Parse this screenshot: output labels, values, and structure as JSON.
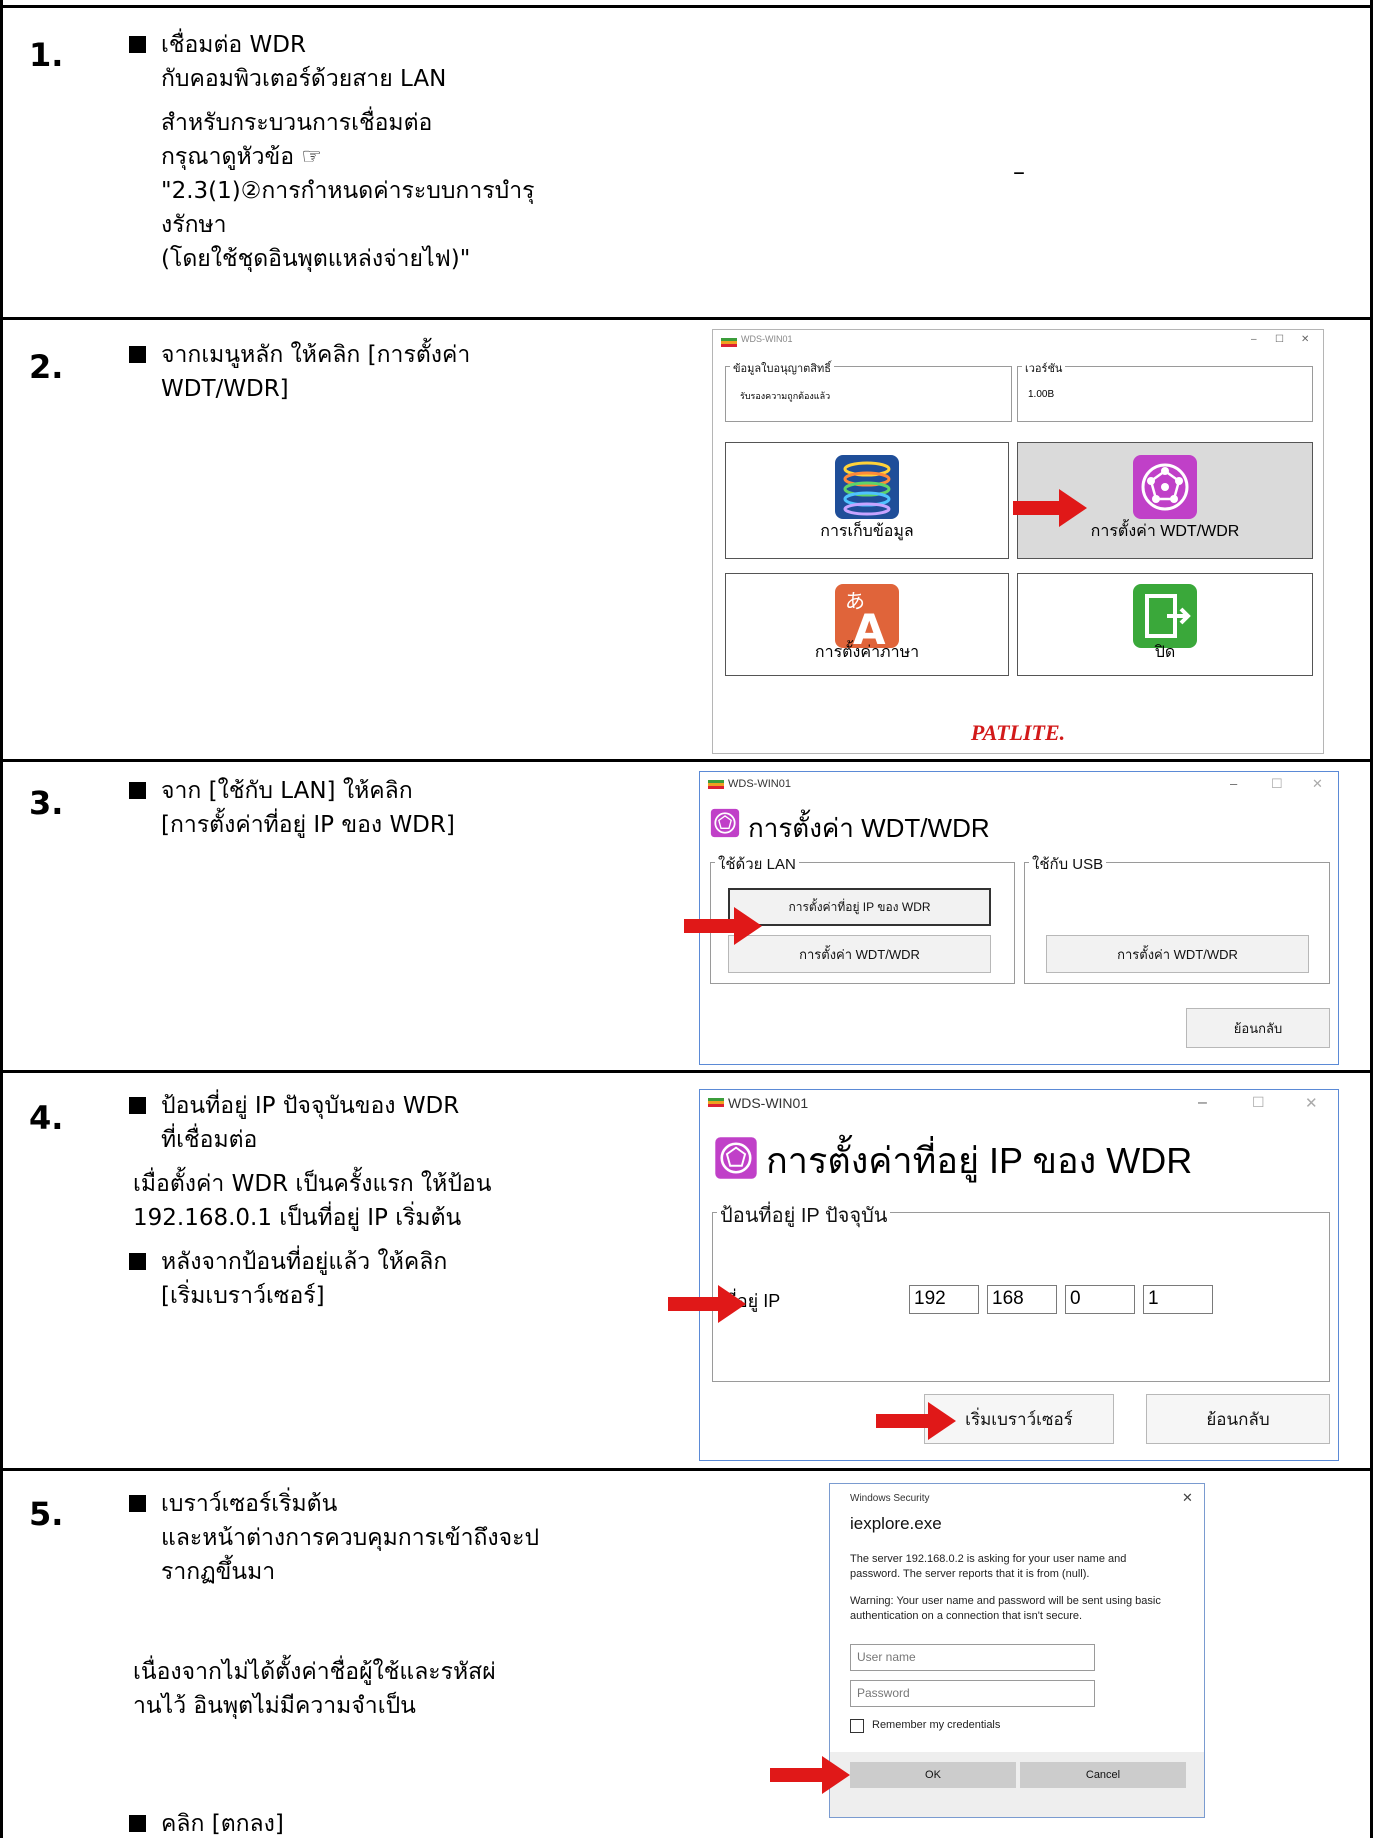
{
  "steps": [
    {
      "number": "1.",
      "lines": [
        "เชื่อมต่อ   WDR",
        "กับคอมพิวเตอร์ด้วยสาย   LAN",
        "สำหรับกระบวนการเชื่อมต่อ",
        "กรุณาดูหัวข้อ  ☞",
        "\"2.3(1)②การกำหนดค่าระบบการบำรุ",
        "งรักษา",
        "(โดยใช้ชุดอินพุตแหล่งจ่ายไฟ)\""
      ],
      "dash": "–"
    },
    {
      "number": "2.",
      "lines": [
        "จากเมนูหลัก   ให้คลิก   [การตั้งค่า",
        "WDT/WDR]"
      ]
    },
    {
      "number": "3.",
      "lines": [
        "จาก   [ใช้กับ   LAN] ให้คลิก",
        "[การตั้งค่าที่อยู่   IP ของ   WDR]"
      ]
    },
    {
      "number": "4.",
      "lines": [
        "ป้อนที่อยู่   IP ปัจจุบันของ   WDR",
        "ที่เชื่อมต่อ",
        "เมื่อตั้งค่า  WDR เป็นครั้งแรก  ให้ป้อน",
        "192.168.0.1 เป็นที่อยู่   IP เริ่มต้น",
        "หลังจากป้อนที่อยู่แล้ว   ให้คลิก",
        "[เริ่มเบราว์เซอร์]"
      ]
    },
    {
      "number": "5.",
      "lines": [
        "เบราว์เซอร์เริ่มต้น",
        "และหน้าต่างการควบคุมการเข้าถึงจะป",
        "รากฏขึ้นมา",
        "เนื่องจากไม่ได้ตั้งค่าชื่อผู้ใช้และรหัสผ่",
        "านไว้   อินพุตไม่มีความจำเป็น",
        "คลิก   [ตกลง]"
      ]
    }
  ],
  "screen2": {
    "window_title": "WDS-WIN01",
    "license_legend": "ข้อมูลใบอนุญาตสิทธิ์",
    "license_value": "รับรองความถูกต้องแล้ว",
    "version_legend": "เวอร์ชัน",
    "version_value": "1.00B",
    "tiles": [
      "การเก็บข้อมูล",
      "การตั้งค่า WDT/WDR",
      "การตั้งค่าภาษา",
      "ปิด"
    ],
    "brand": "PATLITE."
  },
  "screen3": {
    "window_title": "WDS-WIN01",
    "heading": "การตั้งค่า WDT/WDR",
    "lan_legend": "ใช้ด้วย LAN",
    "usb_legend": "ใช้กับ USB",
    "btn_ip": "การตั้งค่าที่อยู่ IP ของ WDR",
    "btn_lan_wdt": "การตั้งค่า WDT/WDR",
    "btn_usb_wdt": "การตั้งค่า WDT/WDR",
    "btn_back": "ย้อนกลับ"
  },
  "screen4": {
    "window_title": "WDS-WIN01",
    "heading": "การตั้งค่าที่อยู่ IP ของ WDR",
    "group_legend": "ป้อนที่อยู่ IP ปัจจุบัน",
    "ip_label": "ที่อยู่ IP",
    "ip": [
      "192",
      "168",
      "0",
      "1"
    ],
    "btn_start": "เริ่มเบราว์เซอร์",
    "btn_back": "ย้อนกลับ"
  },
  "screen5": {
    "dialog_title": "Windows Security",
    "app": "iexplore.exe",
    "message": "The server 192.168.0.2 is asking for your user name and password. The server reports that it is from (null).",
    "warning": "Warning: Your user name and password will be sent using basic authentication on a connection that isn't secure.",
    "username_placeholder": "User name",
    "password_placeholder": "Password",
    "remember": "Remember my credentials",
    "ok": "OK",
    "cancel": "Cancel"
  },
  "colors": {
    "arrow": "#e01818",
    "tile_highlight": "#dadada",
    "window_border": "#5b8ad6"
  }
}
